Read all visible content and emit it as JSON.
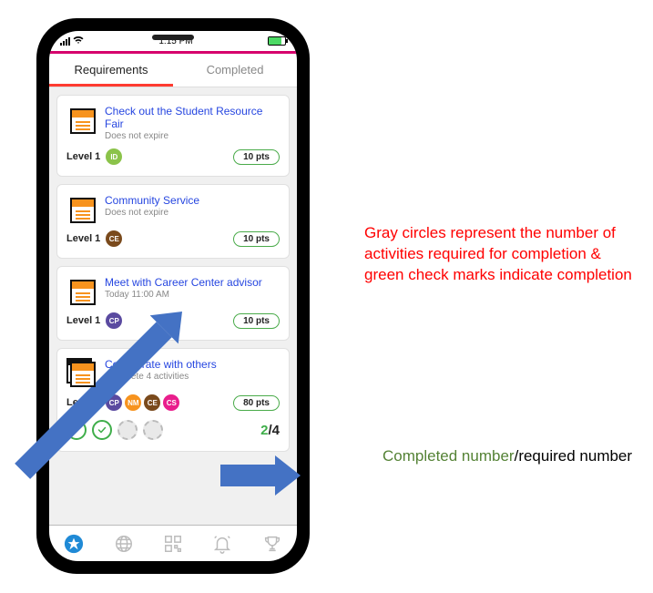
{
  "status_bar": {
    "time": "1:15 PM"
  },
  "tabs": {
    "requirements": "Requirements",
    "completed": "Completed"
  },
  "cards": [
    {
      "title": "Check out the Student Resource Fair",
      "subtitle": "Does not expire",
      "level": "Level 1",
      "chips": [
        {
          "label": "ID",
          "color": "#8bc34a"
        }
      ],
      "pts": "10 pts",
      "multi": false
    },
    {
      "title": "Community Service",
      "subtitle": "Does not expire",
      "level": "Level 1",
      "chips": [
        {
          "label": "CE",
          "color": "#7a4a1c"
        }
      ],
      "pts": "10 pts",
      "multi": false
    },
    {
      "title": "Meet with Career Center advisor",
      "subtitle": "Today 11:00 AM",
      "level": "Level 1",
      "chips": [
        {
          "label": "CP",
          "color": "#5a4aa0"
        }
      ],
      "pts": "10 pts",
      "multi": false
    },
    {
      "title": "Collaborate with others",
      "subtitle": "Complete 4 activities",
      "level": "Level 2",
      "chips": [
        {
          "label": "CP",
          "color": "#5a4aa0"
        },
        {
          "label": "NM",
          "color": "#f7931e"
        },
        {
          "label": "CE",
          "color": "#7a4a1c"
        },
        {
          "label": "CS",
          "color": "#e91e8c"
        }
      ],
      "pts": "80 pts",
      "multi": true,
      "progress": {
        "done": 2,
        "total": 4,
        "done_text": "2",
        "total_text": "/4"
      }
    }
  ],
  "annotations": {
    "red": "Gray circles represent the number of activities required for completion & green check marks indicate completion",
    "green_part": "Completed number",
    "slash": "/",
    "black_part": "required number"
  }
}
